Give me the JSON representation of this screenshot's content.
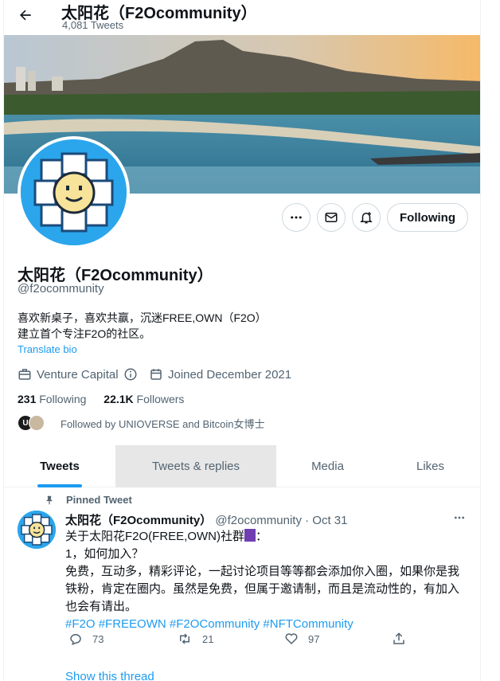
{
  "header": {
    "title": "太阳花（F2Ocommunity）",
    "tweet_count": "4,081 Tweets"
  },
  "profile": {
    "name": "太阳花（F2Ocommunity）",
    "handle": "@f2ocommunity",
    "bio_line1": "喜欢新桌子，喜欢共赢，沉迷FREE,OWN（F2O）",
    "bio_line2": "建立首个专注F2O的社区。",
    "translate_label": "Translate bio",
    "category": "Venture Capital",
    "joined": "Joined December 2021",
    "following_count": "231",
    "following_label": "Following",
    "followers_count": "22.1K",
    "followers_label": "Followers",
    "followed_by": "Followed by UNIOVERSE and Bitcoin女博士"
  },
  "actions": {
    "follow_label": "Following"
  },
  "tabs": [
    {
      "label": "Tweets",
      "active": true
    },
    {
      "label": "Tweets & replies",
      "active": false
    },
    {
      "label": "Media",
      "active": false
    },
    {
      "label": "Likes",
      "active": false
    }
  ],
  "tweet": {
    "pinned_label": "Pinned Tweet",
    "author": "太阳花（F2Ocommunity）",
    "handle_time": "@f2ocommunity · Oct 31",
    "line1_a": "关于太阳花F2O(FREE,OWN)社群",
    "line1_b": "：",
    "line2": "1，如何加入？",
    "line3": "免费，互动多，精彩评论，一起讨论项目等等都会添加你入圈，如果你是我",
    "line4": "铁粉，肯定在圈内。虽然是免费，但属于邀请制，而且是流动性的，有加入",
    "line5": "也会有请出。",
    "hashtags": [
      "#F2O",
      "#FREEOWN",
      "#F2OCommunity",
      "#NFTCommunity"
    ],
    "replies": "73",
    "retweets": "21",
    "likes": "97",
    "show_thread": "Show this thread"
  },
  "colors": {
    "accent": "#1d9bf0",
    "text": "#0f1419",
    "muted": "#536471",
    "border": "#cfd9de"
  }
}
